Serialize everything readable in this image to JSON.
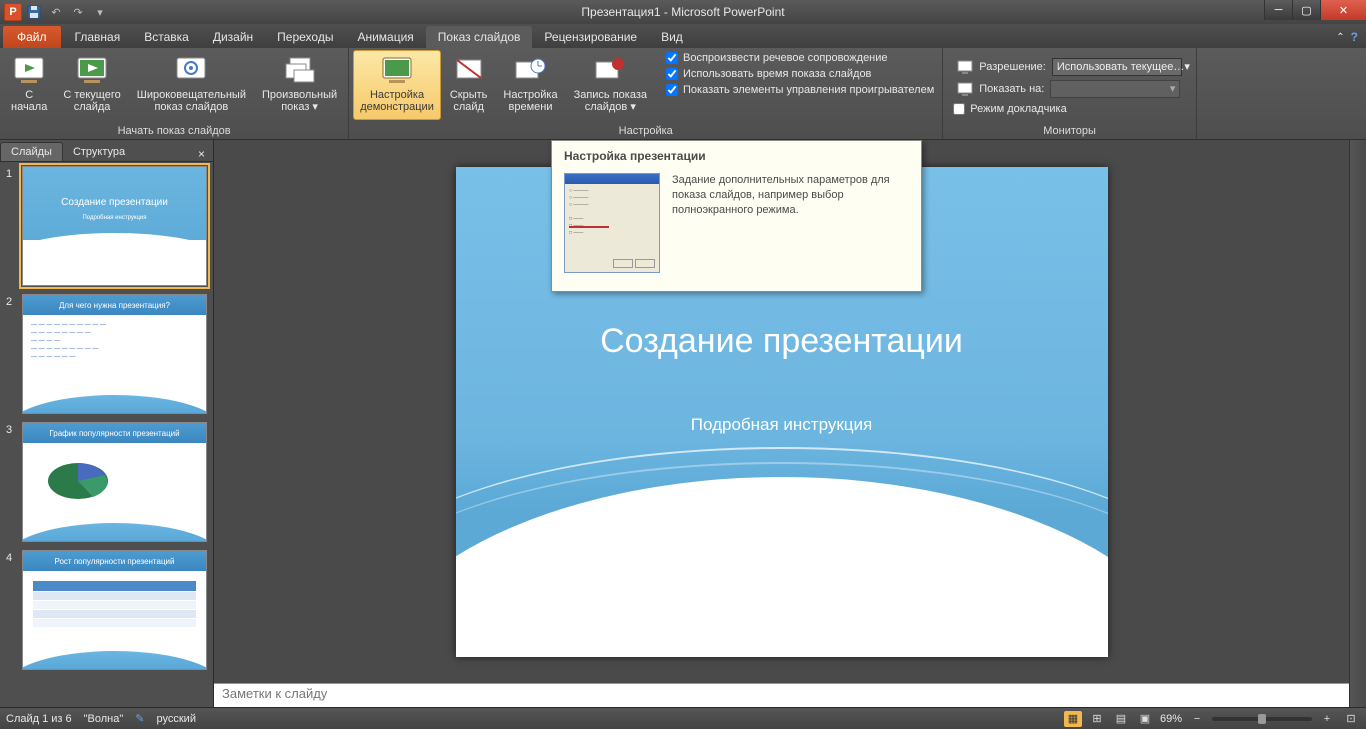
{
  "titlebar": {
    "app_letter": "P",
    "title": "Презентация1 - Microsoft PowerPoint"
  },
  "tabs": {
    "file": "Файл",
    "items": [
      "Главная",
      "Вставка",
      "Дизайн",
      "Переходы",
      "Анимация",
      "Показ слайдов",
      "Рецензирование",
      "Вид"
    ],
    "active_index": 5
  },
  "ribbon": {
    "group1": {
      "label": "Начать показ слайдов",
      "btn_begin": "С\nначала",
      "btn_current": "С текущего\nслайда",
      "btn_broadcast": "Широковещательный\nпоказ слайдов",
      "btn_custom": "Произвольный\nпоказ ▾"
    },
    "group2": {
      "label": "Настройка",
      "btn_setup": "Настройка\nдемонстрации",
      "btn_hide": "Скрыть\nслайд",
      "btn_rehearse": "Настройка\nвремени",
      "btn_record": "Запись показа\nслайдов ▾",
      "chk_narration": "Воспроизвести речевое сопровождение",
      "chk_timings": "Использовать время показа слайдов",
      "chk_controls": "Показать элементы управления проигрывателем"
    },
    "group3": {
      "label": "Мониторы",
      "lbl_resolution": "Разрешение:",
      "val_resolution": "Использовать текущее…",
      "lbl_showon": "Показать на:",
      "chk_presenter": "Режим докладчика"
    }
  },
  "panel": {
    "tab_slides": "Слайды",
    "tab_outline": "Структура",
    "thumbs": [
      {
        "n": "1",
        "title": "Создание презентации",
        "sub": "Подробная инструкция"
      },
      {
        "n": "2",
        "title": "Для чего нужна презентация?"
      },
      {
        "n": "3",
        "title": "График популярности презентаций"
      },
      {
        "n": "4",
        "title": "Рост популярности презентаций"
      }
    ]
  },
  "slide": {
    "title": "Создание презентации",
    "subtitle": "Подробная инструкция"
  },
  "notes": {
    "placeholder": "Заметки к слайду"
  },
  "tooltip": {
    "title": "Настройка презентации",
    "text": "Задание дополнительных параметров для показа слайдов, например выбор полноэкранного режима."
  },
  "status": {
    "slide_info": "Слайд 1 из 6",
    "theme": "\"Волна\"",
    "language": "русский",
    "zoom": "69%"
  }
}
